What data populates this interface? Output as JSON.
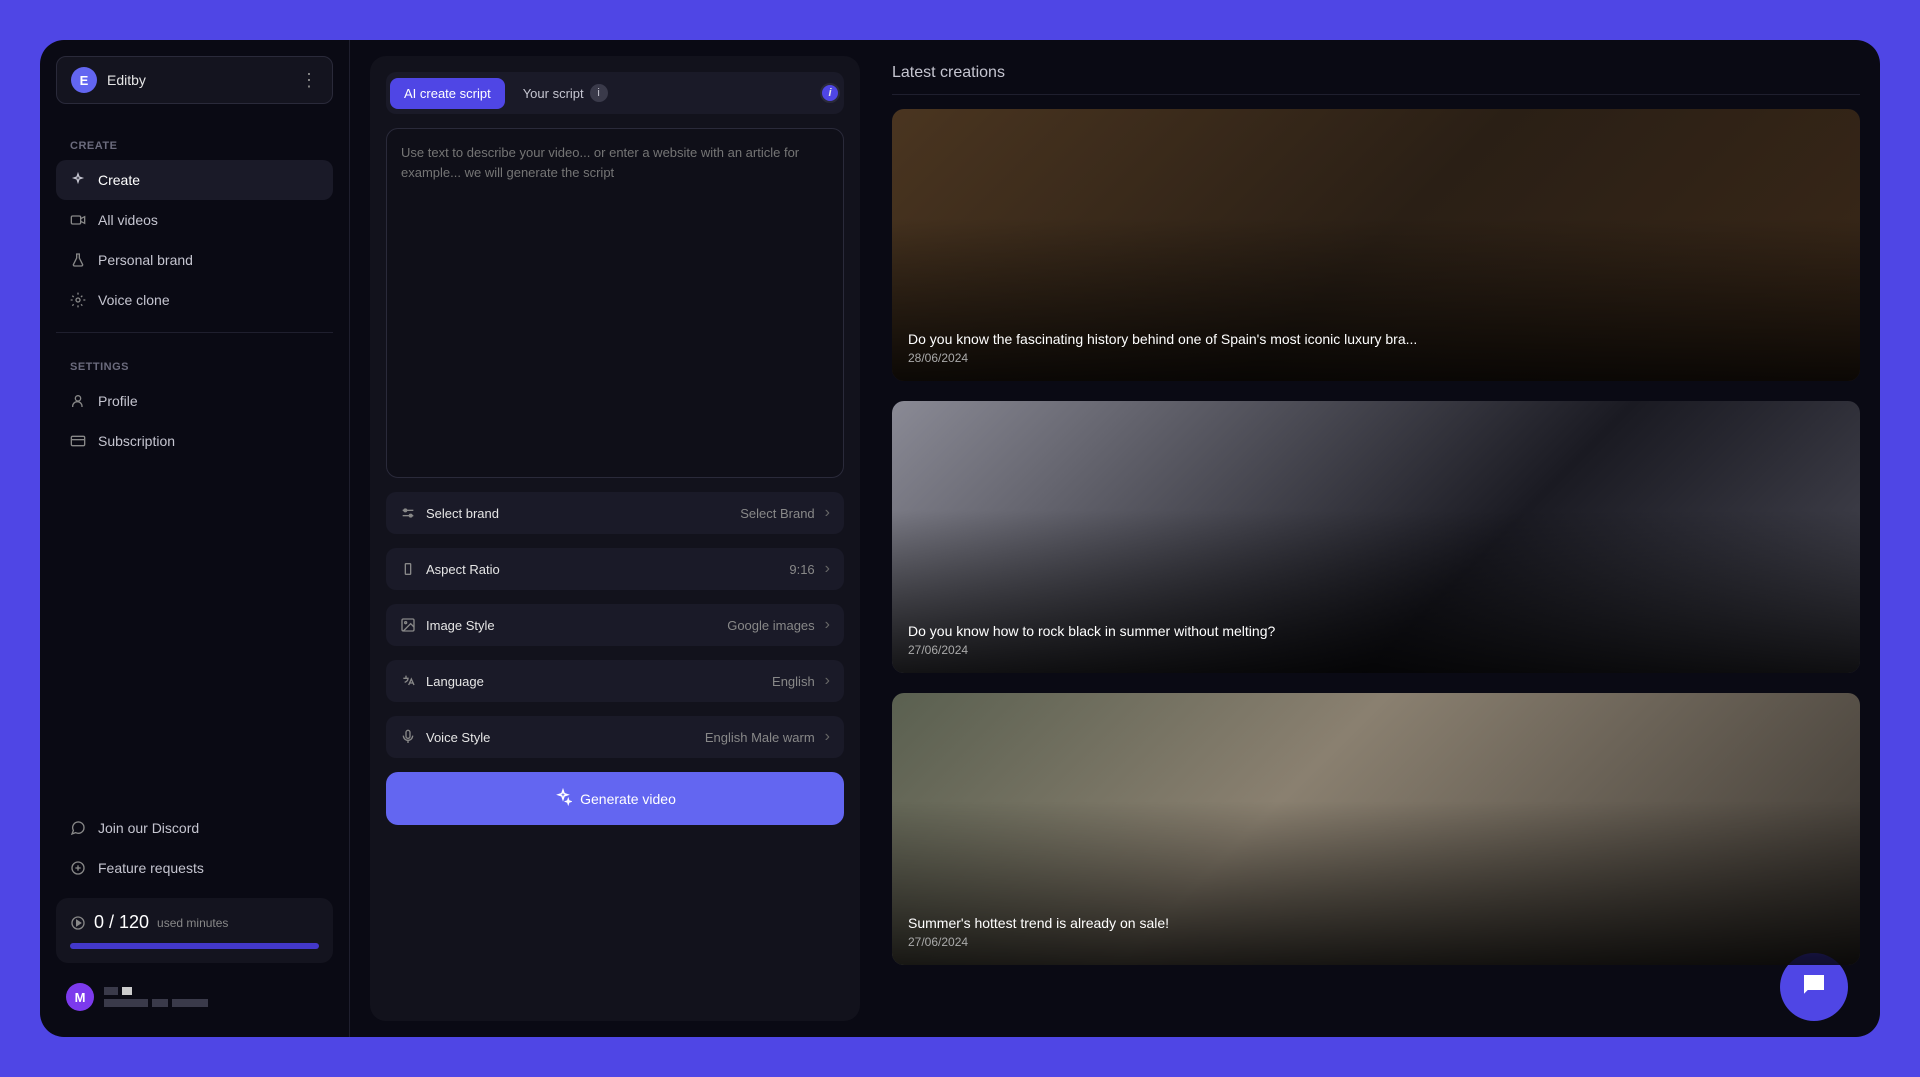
{
  "workspace": {
    "initial": "E",
    "name": "Editby"
  },
  "sidebar": {
    "create_label": "CREATE",
    "settings_label": "SETTINGS",
    "items": {
      "create": "Create",
      "all_videos": "All videos",
      "personal_brand": "Personal brand",
      "voice_clone": "Voice clone",
      "profile": "Profile",
      "subscription": "Subscription"
    },
    "footer": {
      "discord": "Join our Discord",
      "feature_requests": "Feature requests"
    }
  },
  "usage": {
    "count": "0 / 120",
    "label": "used minutes"
  },
  "user": {
    "initial": "M"
  },
  "tabs": {
    "ai": "AI create script",
    "your": "Your script",
    "your_badge": "i",
    "info": "i"
  },
  "prompt": {
    "placeholder": "Use text to describe your video... or enter a website with an article for example... we will generate the script"
  },
  "options": {
    "brand": {
      "label": "Select brand",
      "value": "Select Brand"
    },
    "ratio": {
      "label": "Aspect Ratio",
      "value": "9:16"
    },
    "image": {
      "label": "Image Style",
      "value": "Google images"
    },
    "language": {
      "label": "Language",
      "value": "English"
    },
    "voice": {
      "label": "Voice Style",
      "value": "English Male warm"
    }
  },
  "generate_label": "Generate video",
  "creations": {
    "title": "Latest creations",
    "items": [
      {
        "title": "Do you know the fascinating history behind one of Spain's most iconic luxury bra...",
        "date": "28/06/2024"
      },
      {
        "title": "Do you know how to rock black in summer without melting?",
        "date": "27/06/2024"
      },
      {
        "title": "Summer's hottest trend is already on sale!",
        "date": "27/06/2024"
      }
    ]
  }
}
